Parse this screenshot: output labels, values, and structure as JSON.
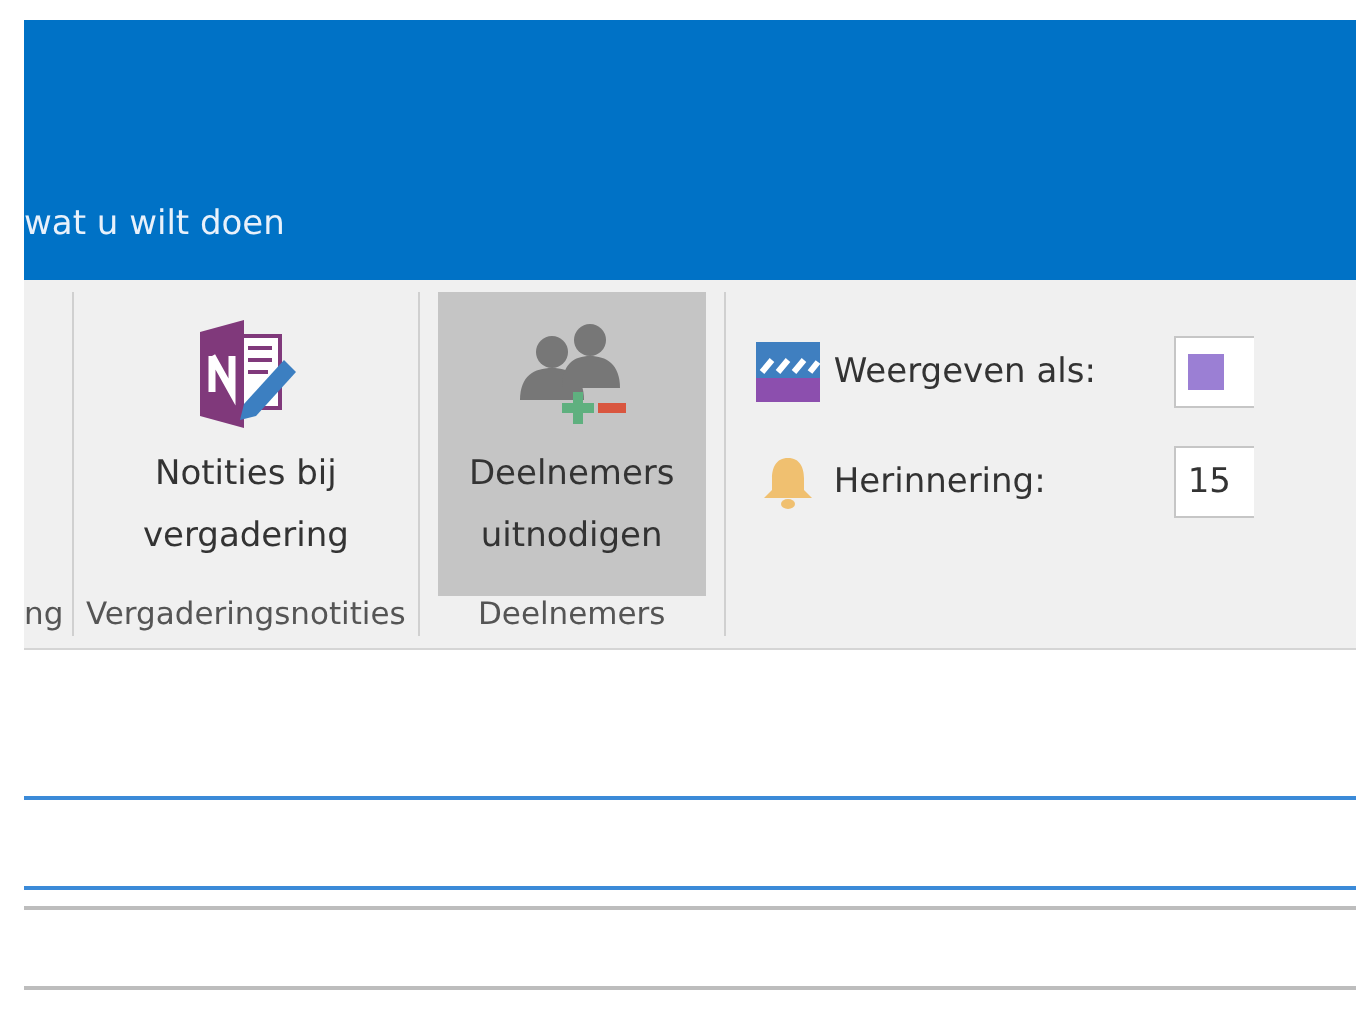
{
  "tell_me": {
    "placeholder": "wat u wilt doen"
  },
  "ribbon": {
    "groups": [
      {
        "label": "ng"
      },
      {
        "label": "Vergaderingsnotities",
        "buttons": [
          {
            "kind": "onenote",
            "label": "Notities bij vergadering",
            "selected": false
          }
        ]
      },
      {
        "label": "Deelnemers",
        "buttons": [
          {
            "kind": "attendees",
            "label": "Deelnemers uitnodigen",
            "selected": true
          }
        ]
      }
    ],
    "fields": [
      {
        "kind": "show_as",
        "label": "Weergeven als:",
        "color": "#9b7fd4"
      },
      {
        "kind": "reminder",
        "label": "Herinnering:",
        "value": "15"
      }
    ]
  }
}
